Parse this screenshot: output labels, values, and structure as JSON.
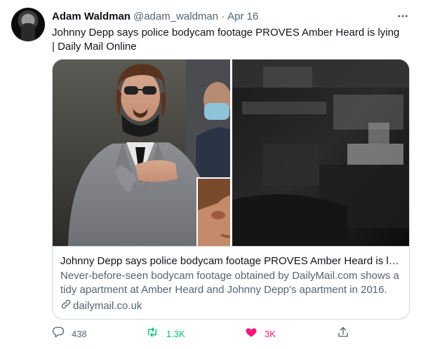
{
  "tweet": {
    "author_name": "Adam Waldman",
    "author_handle": "@adam_waldman",
    "separator": "·",
    "date": "Apr 16",
    "text": "Johnny Depp says police bodycam footage PROVES Amber Heard is lying | Daily Mail Online"
  },
  "card": {
    "title": "Johnny Depp says police bodycam footage PROVES Amber Heard is lying",
    "description": "Never-before-seen bodycam footage obtained by DailyMail.com shows a tidy apartment at Amber Heard and Johnny Depp's apartment in 2016.",
    "domain": "dailymail.co.uk"
  },
  "actions": {
    "replies": "438",
    "retweets": "1.3K",
    "likes": "3K"
  },
  "colors": {
    "retweet": "#00ba7c",
    "like": "#f91880",
    "secondary_text": "#536471",
    "border": "#cfd9de"
  },
  "icons": {
    "more": "more-horizontal-icon",
    "reply": "reply-icon",
    "retweet": "retweet-icon",
    "like": "heart-filled-icon",
    "share": "share-icon",
    "link": "link-icon"
  }
}
